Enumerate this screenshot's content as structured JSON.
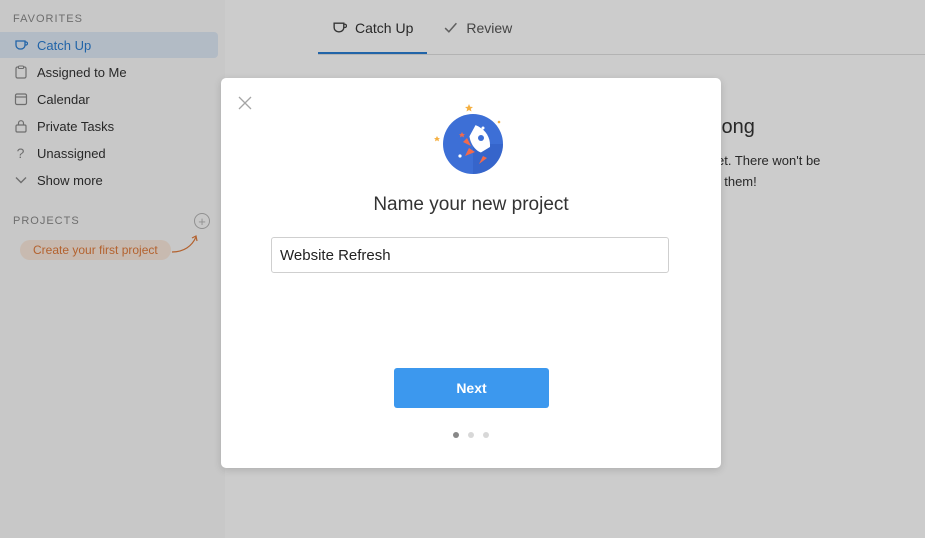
{
  "sidebar": {
    "favorites_title": "FAVORITES",
    "items": [
      {
        "label": "Catch Up",
        "icon": "cup-icon",
        "active": true
      },
      {
        "label": "Assigned to Me",
        "icon": "clipboard-icon",
        "active": false
      },
      {
        "label": "Calendar",
        "icon": "calendar-icon",
        "active": false
      },
      {
        "label": "Private Tasks",
        "icon": "lock-icon",
        "active": false
      },
      {
        "label": "Unassigned",
        "icon": "question-icon",
        "active": false
      },
      {
        "label": "Show more",
        "icon": "chevron-down-icon",
        "active": false
      }
    ],
    "projects_title": "PROJECTS",
    "add_project_icon": "plus-circle-icon",
    "create_hint": "Create your first project"
  },
  "tabs": [
    {
      "label": "Catch Up",
      "icon": "cup-icon",
      "active": true
    },
    {
      "label": "Review",
      "icon": "check-icon",
      "active": false
    }
  ],
  "background": {
    "heading_fragment": "long",
    "text_line1": "et. There won't be",
    "text_line2": "t them!"
  },
  "modal": {
    "title": "Name your new project",
    "input_value": "Website Refresh",
    "next_label": "Next",
    "illustration": "rocket-icon",
    "close_icon": "close-icon",
    "steps_total": 3,
    "step_current": 1
  },
  "colors": {
    "accent": "#2a7ed3",
    "button": "#3c98ee",
    "hint_bg": "#fbe9dc",
    "hint_text": "#e07b3b"
  }
}
